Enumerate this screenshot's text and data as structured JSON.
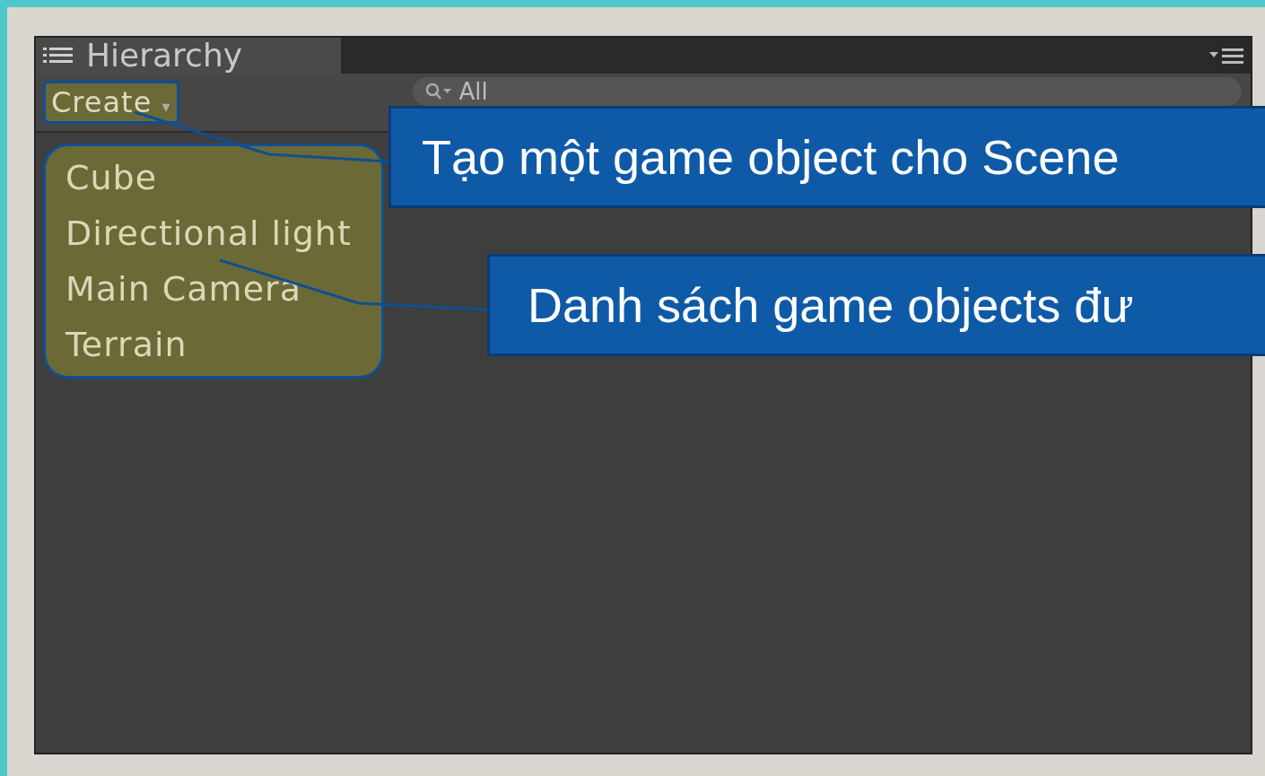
{
  "panel": {
    "tab": "Hierarchy",
    "create_button": "Create",
    "create_caret": "▾",
    "search": {
      "placeholder": "All"
    }
  },
  "menu_items": [
    "Cube",
    "Directional light",
    "Main Camera",
    "Terrain"
  ],
  "callouts": [
    "Tạo một game object cho Scene",
    "Danh sách game objects đư"
  ]
}
